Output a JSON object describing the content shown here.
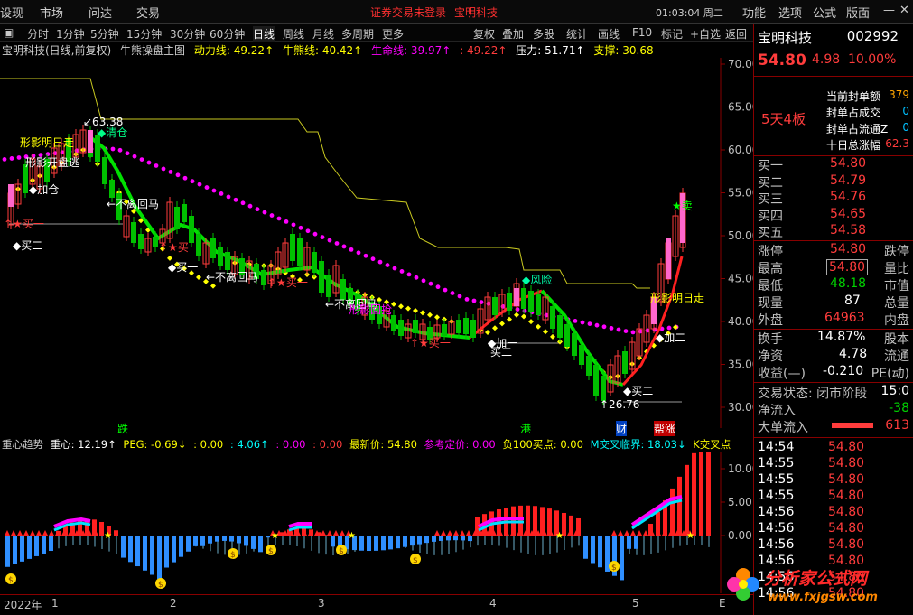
{
  "menu": {
    "m1": "设现",
    "m2": "市场",
    "m3": "问达",
    "m4": "交易",
    "warn1": "证券交易未登录",
    "warn2": "宝明科技",
    "clock": "01:03:04 周二",
    "r1": "功能",
    "r2": "选项",
    "r3": "公式",
    "r4": "版面",
    "min": "—",
    "close": "✕"
  },
  "toolbar": [
    "分时",
    "1分钟",
    "5分钟",
    "15分钟",
    "30分钟",
    "60分钟",
    "日线",
    "周线",
    "月线",
    "多周期",
    "更多",
    "复权",
    "叠加",
    "多股",
    "统计",
    "画线",
    "F10",
    "标记",
    "+自选",
    "返回"
  ],
  "toolbar_active": "日线",
  "main_info": {
    "title": "宝明科技(日线,前复权)",
    "indicator": "牛熊操盘主图",
    "l1": "动力线: 49.22↑",
    "l2": "牛熊线: 40.42↑",
    "l3": "生命线: 39.97↑",
    "l4": ": 49.22↑",
    "l5": "压力: 51.71↑",
    "l6": "支撑: 30.68"
  },
  "y_axis": [
    "70.00",
    "65.00",
    "60.00",
    "55.00",
    "50.00",
    "45.00",
    "40.00",
    "35.00",
    "30.00"
  ],
  "chart_text": {
    "hi": "63.38",
    "lo": "26.76",
    "qc": "清仓",
    "jt1": "形影明日走",
    "jt2": "形影开盘逃",
    "bl1": "←不离回马",
    "bl2": "←不离回马",
    "bl3": "←不离回马",
    "fx": "风险",
    "jt3": "形影明日走",
    "jb": "形影回抢",
    "mr": "买一",
    "mr2": "买二",
    "jc": "加仓",
    "jy": "加一",
    "jy2": "加二",
    "qc2": "清仓"
  },
  "mid_labels": {
    "a": "跌",
    "b": "港",
    "c": "财",
    "d": "帮涨"
  },
  "ind_info": {
    "name": "重心趋势",
    "v1": "重心: 12.19↑",
    "v2": "PEG: -0.69↓",
    "v3": ": 0.00",
    "v4": ": 4.06↑",
    "v5": ": 0.00",
    "v6": ": 0.00",
    "v7": "最新价: 54.80",
    "v8": "参考定价: 0.00",
    "v9": "负100买点: 0.00",
    "v10": "M交叉临界: 18.03↓",
    "v11": "K交叉点"
  },
  "ind_axis": [
    "10.00",
    "5.00",
    "0.00"
  ],
  "date_axis": {
    "y": "2022年",
    "m1": "1",
    "m2": "2",
    "m3": "3",
    "m4": "4",
    "m5": "5",
    "e": "E"
  },
  "panel": {
    "name": "宝明科技",
    "code": "002992",
    "price": "54.80",
    "chg": "4.98",
    "pct": "10.00%",
    "streak": "5天4板",
    "q1": "当前封单额",
    "q1v": "379",
    "q2": "封单占成交",
    "q2v": "0",
    "q3": "封单占流通Z",
    "q3v": "0",
    "q4": "十日总涨幅",
    "q4v": "62.3",
    "bids": [
      {
        "l": "买一",
        "p": "54.80"
      },
      {
        "l": "买二",
        "p": "54.79"
      },
      {
        "l": "买三",
        "p": "54.76"
      },
      {
        "l": "买四",
        "p": "54.65"
      },
      {
        "l": "买五",
        "p": "54.58"
      }
    ],
    "zt": "涨停",
    "ztv": "54.80",
    "dt": "跌停",
    "zg": "最高",
    "zgv": "54.80",
    "lb": "量比",
    "zd": "最低",
    "zdv": "48.18",
    "sz": "市值",
    "xl": "现量",
    "xlv": "87",
    "zl": "总量",
    "wp": "外盘",
    "wpv": "64963",
    "np": "内盘",
    "hs": "换手",
    "hsv": "14.87%",
    "gb": "股本",
    "jz": "净资",
    "jzv": "4.78",
    "lt": "流通",
    "sy": "收益(—)",
    "syv": "-0.210",
    "pe": "PE(动)",
    "jy": "交易状态: 闭市阶段",
    "jyt": "15:0",
    "jl": "净流入",
    "jlv": "-38",
    "dd": "大单流入",
    "ddv": "613",
    "ticks": [
      {
        "t": "14:54",
        "p": "54.80"
      },
      {
        "t": "14:55",
        "p": "54.80"
      },
      {
        "t": "14:55",
        "p": "54.80"
      },
      {
        "t": "14:55",
        "p": "54.80"
      },
      {
        "t": "14:56",
        "p": "54.80"
      },
      {
        "t": "14:56",
        "p": "54.80"
      },
      {
        "t": "14:56",
        "p": "54.80"
      },
      {
        "t": "14:56",
        "p": "54.80"
      },
      {
        "t": "14:56",
        "p": "54.80"
      },
      {
        "t": "14:56",
        "p": "54.80"
      }
    ]
  },
  "watermark": {
    "w1": "分析家公式网",
    "w2": "www.fxjgsw.com"
  },
  "colors": {
    "up": "#ff3c3c",
    "down": "#00c0ff",
    "green": "#00d000",
    "magenta": "#ff00ff",
    "yellow": "#ffff00"
  }
}
